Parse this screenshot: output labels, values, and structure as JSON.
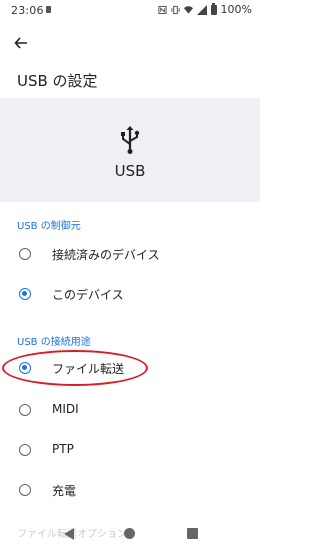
{
  "status_bar": {
    "time": "23:06",
    "battery": "100%"
  },
  "app_bar": {
    "title": "USB の設定"
  },
  "header": {
    "label": "USB",
    "icon": "usb-icon"
  },
  "controller_section": {
    "title": "USB の制御元",
    "options": [
      {
        "label": "接続済みのデバイス",
        "selected": false
      },
      {
        "label": "このデバイス",
        "selected": true
      }
    ]
  },
  "usage_section": {
    "title": "USB の接続用途",
    "options": [
      {
        "label": "ファイル転送",
        "selected": true
      },
      {
        "label": "MIDI",
        "selected": false
      },
      {
        "label": "PTP",
        "selected": false
      },
      {
        "label": "充電",
        "selected": false
      }
    ]
  },
  "partial_hidden_text": "ファイル転送オプション",
  "colors": {
    "accent": "#1a73e8",
    "highlight": "#d81f26",
    "header_bg": "#eef0f4"
  }
}
